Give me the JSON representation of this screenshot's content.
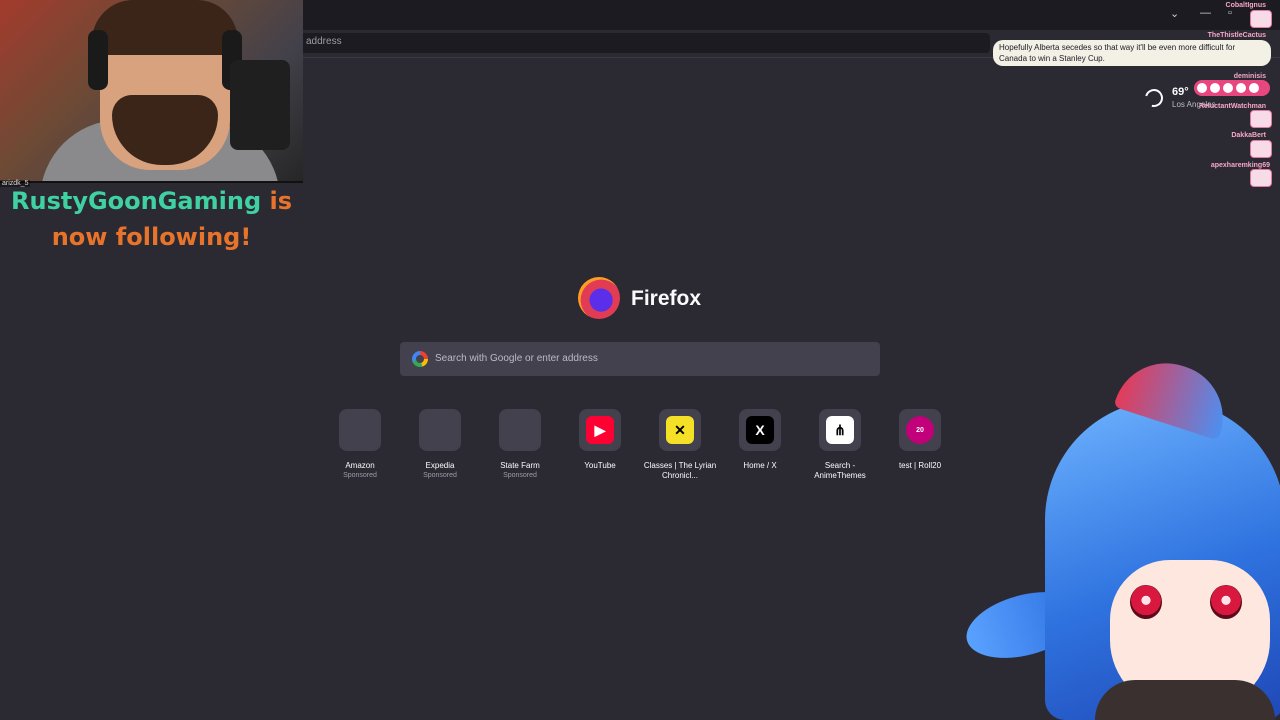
{
  "browser": {
    "url_placeholder": "address",
    "window_controls": {
      "chevron": "⌄",
      "minimize": "—",
      "maximize": "▫"
    }
  },
  "stream": {
    "webcam_label": "arizdk_5",
    "follow": {
      "name": "RustyGoonGaming",
      "word_is": "is",
      "line2": "now following!"
    }
  },
  "newtab": {
    "brand": "Firefox",
    "search_placeholder": "Search with Google or enter address",
    "top_sites": [
      {
        "label": "Amazon",
        "sub": "Sponsored",
        "icon": "blank-icon"
      },
      {
        "label": "Expedia",
        "sub": "Sponsored",
        "icon": "blank-icon"
      },
      {
        "label": "State Farm",
        "sub": "Sponsored",
        "icon": "blank-icon"
      },
      {
        "label": "YouTube",
        "sub": "",
        "icon": "youtube-icon",
        "glyph": "▶",
        "color": "#ff0033"
      },
      {
        "label": "Classes | The Lyrian Chronicl...",
        "sub": "",
        "icon": "lyrian-icon",
        "glyph": "✕",
        "color": "#f5e028"
      },
      {
        "label": "Home / X",
        "sub": "",
        "icon": "x-icon",
        "glyph": "X",
        "color": "#000000"
      },
      {
        "label": "Search - AnimeThemes",
        "sub": "",
        "icon": "animethemes-icon",
        "glyph": "⋔",
        "color": "#ffffff"
      },
      {
        "label": "test | Roll20",
        "sub": "",
        "icon": "roll20-icon",
        "glyph": "20",
        "color": "#c2007a"
      }
    ],
    "weather": {
      "temp": "69°",
      "city": "Los Angeles"
    }
  },
  "chat": {
    "message": "Hopefully Alberta secedes so that way it'll be even more difficult for Canada to win a Stanley Cup.",
    "users": [
      "CobaltIgnus",
      "TheThistleCactus",
      "deminisis",
      "ReluctantWatchman",
      "DakkaBert",
      "apexharemking69"
    ]
  }
}
